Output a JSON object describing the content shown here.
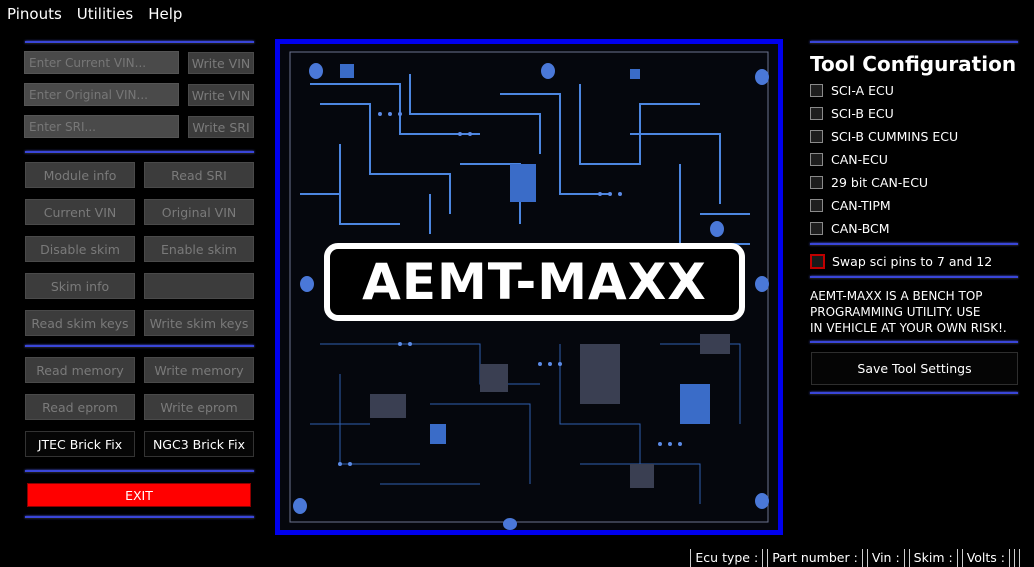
{
  "menu": [
    "Pinouts",
    "Utilities",
    "Help"
  ],
  "vin": {
    "current_placeholder": "Enter Current VIN...",
    "original_placeholder": "Enter Original VIN...",
    "sri_placeholder": "Enter SRI...",
    "write_vin_1": "Write VIN",
    "write_vin_2": "Write VIN",
    "write_sri": "Write SRI"
  },
  "buttons": {
    "module_info": "Module info",
    "read_sri": "Read SRI",
    "current_vin": "Current VIN",
    "original_vin": "Original VIN",
    "disable_skim": "Disable skim",
    "enable_skim": "Enable skim",
    "skim_info": "Skim info",
    "blank": "",
    "read_skim_keys": "Read skim keys",
    "write_skim_keys": "Write skim keys",
    "read_memory": "Read memory",
    "write_memory": "Write memory",
    "read_eprom": "Read eprom",
    "write_eprom": "Write eprom",
    "jtec_brick_fix": "JTEC Brick Fix",
    "ngc3_brick_fix": "NGC3 Brick Fix",
    "exit": "EXIT"
  },
  "logo": "AEMT-MAXX",
  "config": {
    "title": "Tool Configuration",
    "options": [
      "SCI-A ECU",
      "SCI-B ECU",
      "SCI-B CUMMINS ECU",
      "CAN-ECU",
      "29 bit CAN-ECU",
      "CAN-TIPM",
      "CAN-BCM"
    ],
    "swap": "Swap sci pins to 7 and 12",
    "notice": "AEMT-MAXX IS A BENCH TOP\nPROGRAMMING UTILITY. USE\nIN VEHICLE AT YOUR OWN RISK!.",
    "save": "Save Tool Settings"
  },
  "status": {
    "ecu_type": "Ecu type :",
    "part_number": "Part number :",
    "vin": "Vin :",
    "skim": "Skim :",
    "volts": "Volts :"
  },
  "colors": {
    "accent": "#0000ee",
    "exit": "#ff0000",
    "separator": "#3a46d8"
  }
}
